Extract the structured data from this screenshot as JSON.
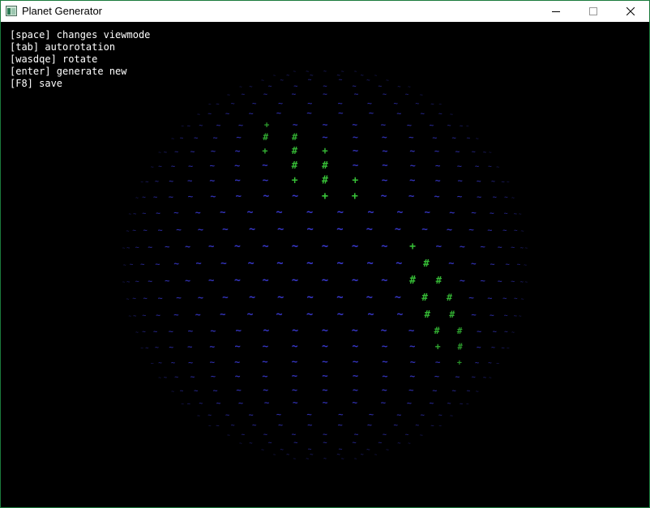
{
  "window": {
    "title": "Planet Generator",
    "controls": {
      "minimize": "minimize-icon",
      "maximize": "maximize-icon",
      "close": "close-icon"
    }
  },
  "help_lines": [
    "[space] changes viewmode",
    "[tab] autorotation",
    "[wasdqe] rotate",
    "[enter] generate new",
    "[F8] save"
  ],
  "planet": {
    "glyphs": {
      "water": "~",
      "shore": "+",
      "land": "#"
    },
    "colors": {
      "water": "#3b3bd6",
      "shore": "#3ccf3c",
      "land": "#3ccf3c",
      "background": "#000000"
    }
  }
}
